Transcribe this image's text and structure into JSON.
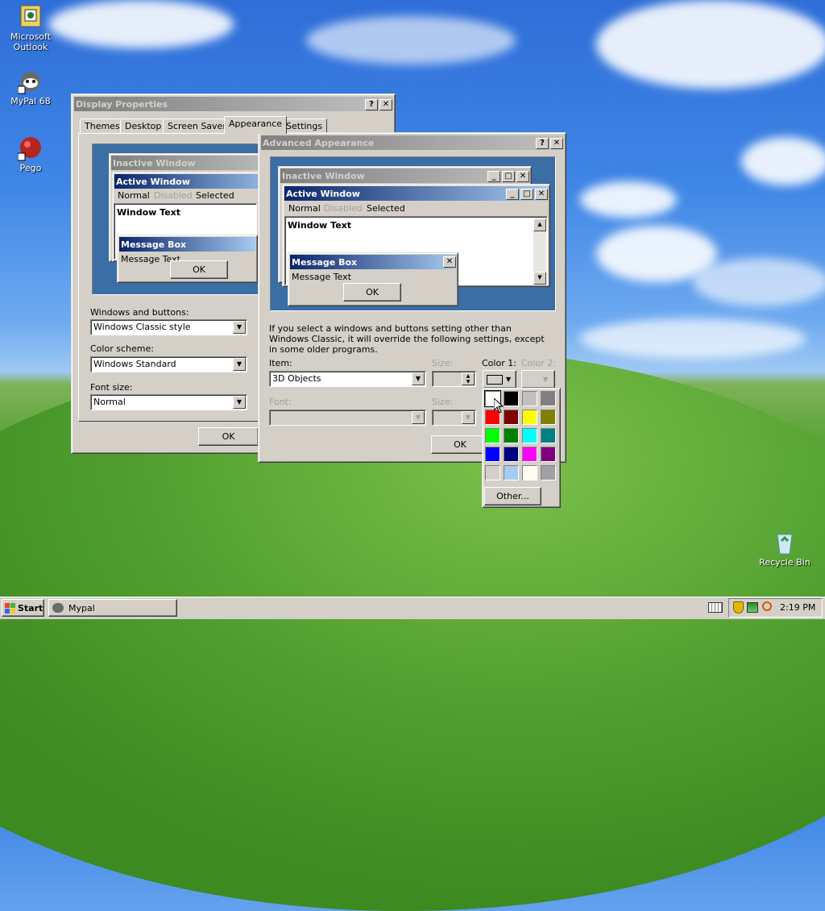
{
  "desktop": {
    "icons": [
      {
        "label": "Microsoft Outlook"
      },
      {
        "label": "MyPal 68"
      },
      {
        "label": "Pego"
      },
      {
        "label": "Recycle Bin"
      }
    ]
  },
  "display_properties": {
    "title": "Display Properties",
    "tabs": [
      "Themes",
      "Desktop",
      "Screen Saver",
      "Appearance",
      "Settings"
    ],
    "active_tab": "Appearance",
    "preview": {
      "inactive_title": "Inactive Window",
      "active_title": "Active Window",
      "menu": [
        "Normal",
        "Disabled",
        "Selected"
      ],
      "window_text": "Window Text",
      "msgbox_title": "Message Box",
      "msgbox_text": "Message Text",
      "ok": "OK"
    },
    "windows_buttons_label": "Windows and buttons:",
    "windows_buttons_value": "Windows Classic style",
    "color_scheme_label": "Color scheme:",
    "color_scheme_value": "Windows Standard",
    "font_size_label": "Font size:",
    "font_size_value": "Normal",
    "ok": "OK"
  },
  "advanced": {
    "title": "Advanced Appearance",
    "preview": {
      "inactive_title": "Inactive Window",
      "active_title": "Active Window",
      "menu": [
        "Normal",
        "Disabled",
        "Selected"
      ],
      "window_text": "Window Text",
      "msgbox_title": "Message Box",
      "msgbox_text": "Message Text",
      "ok": "OK"
    },
    "info": "If you select a windows and buttons setting other than Windows Classic, it will override the following settings, except in some older programs.",
    "item_label": "Item:",
    "item_value": "3D Objects",
    "size_label": "Size:",
    "color1_label": "Color 1:",
    "color2_label": "Color 2:",
    "font_label": "Font:",
    "font_size_label": "Size:",
    "ok": "OK"
  },
  "color_picker": {
    "colors": [
      "#ffffff",
      "#000000",
      "#c0c0c0",
      "#808080",
      "#ff0000",
      "#800000",
      "#ffff00",
      "#808000",
      "#00ff00",
      "#008000",
      "#00ffff",
      "#008080",
      "#0000ff",
      "#000080",
      "#ff00ff",
      "#800080",
      "#d4d0c8",
      "#a6caf0",
      "#fffbf0",
      "#a0a0a4"
    ],
    "selected": "#ffffff",
    "other_label": "Other..."
  },
  "taskbar": {
    "start_label": "Start",
    "task": "Mypal",
    "clock": "2:19 PM"
  }
}
